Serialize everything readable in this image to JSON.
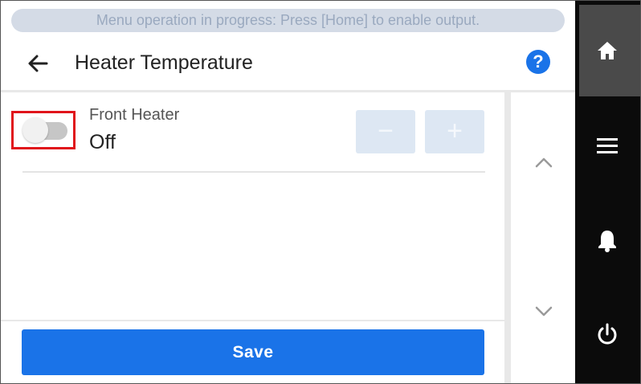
{
  "banner": {
    "text": "Menu operation in progress: Press [Home] to enable output."
  },
  "header": {
    "title": "Heater Temperature",
    "help_label": "?"
  },
  "item": {
    "label": "Front Heater",
    "value": "Off",
    "minus_label": "−",
    "plus_label": "+",
    "toggle_on": false
  },
  "footer": {
    "save_label": "Save"
  },
  "nav": [
    "home-icon",
    "menu-icon",
    "bell-icon",
    "power-icon"
  ],
  "colors": {
    "accent": "#1a73e8",
    "highlight": "#e0141b",
    "nav_bg": "#0b0b0b",
    "nav_active": "#4a4a4a"
  }
}
